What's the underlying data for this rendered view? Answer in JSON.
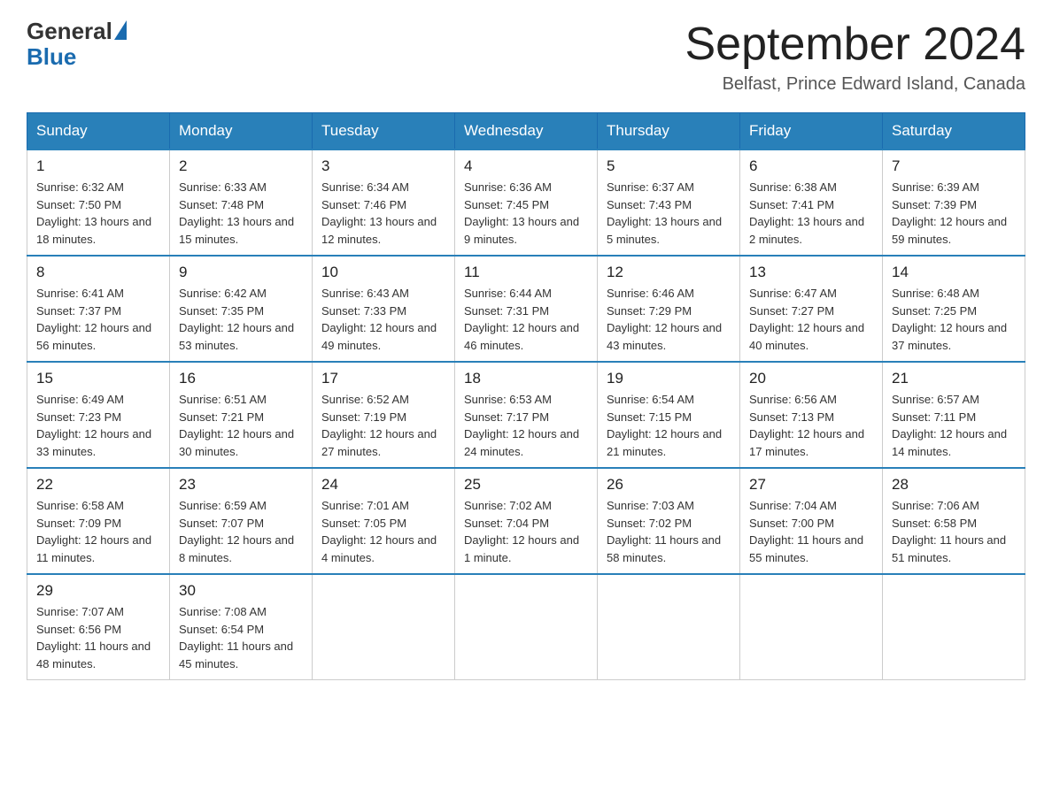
{
  "header": {
    "logo_general": "General",
    "logo_blue": "Blue",
    "month_year": "September 2024",
    "location": "Belfast, Prince Edward Island, Canada"
  },
  "weekdays": [
    "Sunday",
    "Monday",
    "Tuesday",
    "Wednesday",
    "Thursday",
    "Friday",
    "Saturday"
  ],
  "weeks": [
    [
      {
        "day": "1",
        "sunrise": "6:32 AM",
        "sunset": "7:50 PM",
        "daylight": "13 hours and 18 minutes."
      },
      {
        "day": "2",
        "sunrise": "6:33 AM",
        "sunset": "7:48 PM",
        "daylight": "13 hours and 15 minutes."
      },
      {
        "day": "3",
        "sunrise": "6:34 AM",
        "sunset": "7:46 PM",
        "daylight": "13 hours and 12 minutes."
      },
      {
        "day": "4",
        "sunrise": "6:36 AM",
        "sunset": "7:45 PM",
        "daylight": "13 hours and 9 minutes."
      },
      {
        "day": "5",
        "sunrise": "6:37 AM",
        "sunset": "7:43 PM",
        "daylight": "13 hours and 5 minutes."
      },
      {
        "day": "6",
        "sunrise": "6:38 AM",
        "sunset": "7:41 PM",
        "daylight": "13 hours and 2 minutes."
      },
      {
        "day": "7",
        "sunrise": "6:39 AM",
        "sunset": "7:39 PM",
        "daylight": "12 hours and 59 minutes."
      }
    ],
    [
      {
        "day": "8",
        "sunrise": "6:41 AM",
        "sunset": "7:37 PM",
        "daylight": "12 hours and 56 minutes."
      },
      {
        "day": "9",
        "sunrise": "6:42 AM",
        "sunset": "7:35 PM",
        "daylight": "12 hours and 53 minutes."
      },
      {
        "day": "10",
        "sunrise": "6:43 AM",
        "sunset": "7:33 PM",
        "daylight": "12 hours and 49 minutes."
      },
      {
        "day": "11",
        "sunrise": "6:44 AM",
        "sunset": "7:31 PM",
        "daylight": "12 hours and 46 minutes."
      },
      {
        "day": "12",
        "sunrise": "6:46 AM",
        "sunset": "7:29 PM",
        "daylight": "12 hours and 43 minutes."
      },
      {
        "day": "13",
        "sunrise": "6:47 AM",
        "sunset": "7:27 PM",
        "daylight": "12 hours and 40 minutes."
      },
      {
        "day": "14",
        "sunrise": "6:48 AM",
        "sunset": "7:25 PM",
        "daylight": "12 hours and 37 minutes."
      }
    ],
    [
      {
        "day": "15",
        "sunrise": "6:49 AM",
        "sunset": "7:23 PM",
        "daylight": "12 hours and 33 minutes."
      },
      {
        "day": "16",
        "sunrise": "6:51 AM",
        "sunset": "7:21 PM",
        "daylight": "12 hours and 30 minutes."
      },
      {
        "day": "17",
        "sunrise": "6:52 AM",
        "sunset": "7:19 PM",
        "daylight": "12 hours and 27 minutes."
      },
      {
        "day": "18",
        "sunrise": "6:53 AM",
        "sunset": "7:17 PM",
        "daylight": "12 hours and 24 minutes."
      },
      {
        "day": "19",
        "sunrise": "6:54 AM",
        "sunset": "7:15 PM",
        "daylight": "12 hours and 21 minutes."
      },
      {
        "day": "20",
        "sunrise": "6:56 AM",
        "sunset": "7:13 PM",
        "daylight": "12 hours and 17 minutes."
      },
      {
        "day": "21",
        "sunrise": "6:57 AM",
        "sunset": "7:11 PM",
        "daylight": "12 hours and 14 minutes."
      }
    ],
    [
      {
        "day": "22",
        "sunrise": "6:58 AM",
        "sunset": "7:09 PM",
        "daylight": "12 hours and 11 minutes."
      },
      {
        "day": "23",
        "sunrise": "6:59 AM",
        "sunset": "7:07 PM",
        "daylight": "12 hours and 8 minutes."
      },
      {
        "day": "24",
        "sunrise": "7:01 AM",
        "sunset": "7:05 PM",
        "daylight": "12 hours and 4 minutes."
      },
      {
        "day": "25",
        "sunrise": "7:02 AM",
        "sunset": "7:04 PM",
        "daylight": "12 hours and 1 minute."
      },
      {
        "day": "26",
        "sunrise": "7:03 AM",
        "sunset": "7:02 PM",
        "daylight": "11 hours and 58 minutes."
      },
      {
        "day": "27",
        "sunrise": "7:04 AM",
        "sunset": "7:00 PM",
        "daylight": "11 hours and 55 minutes."
      },
      {
        "day": "28",
        "sunrise": "7:06 AM",
        "sunset": "6:58 PM",
        "daylight": "11 hours and 51 minutes."
      }
    ],
    [
      {
        "day": "29",
        "sunrise": "7:07 AM",
        "sunset": "6:56 PM",
        "daylight": "11 hours and 48 minutes."
      },
      {
        "day": "30",
        "sunrise": "7:08 AM",
        "sunset": "6:54 PM",
        "daylight": "11 hours and 45 minutes."
      },
      null,
      null,
      null,
      null,
      null
    ]
  ],
  "labels": {
    "sunrise_prefix": "Sunrise: ",
    "sunset_prefix": "Sunset: ",
    "daylight_prefix": "Daylight: "
  }
}
